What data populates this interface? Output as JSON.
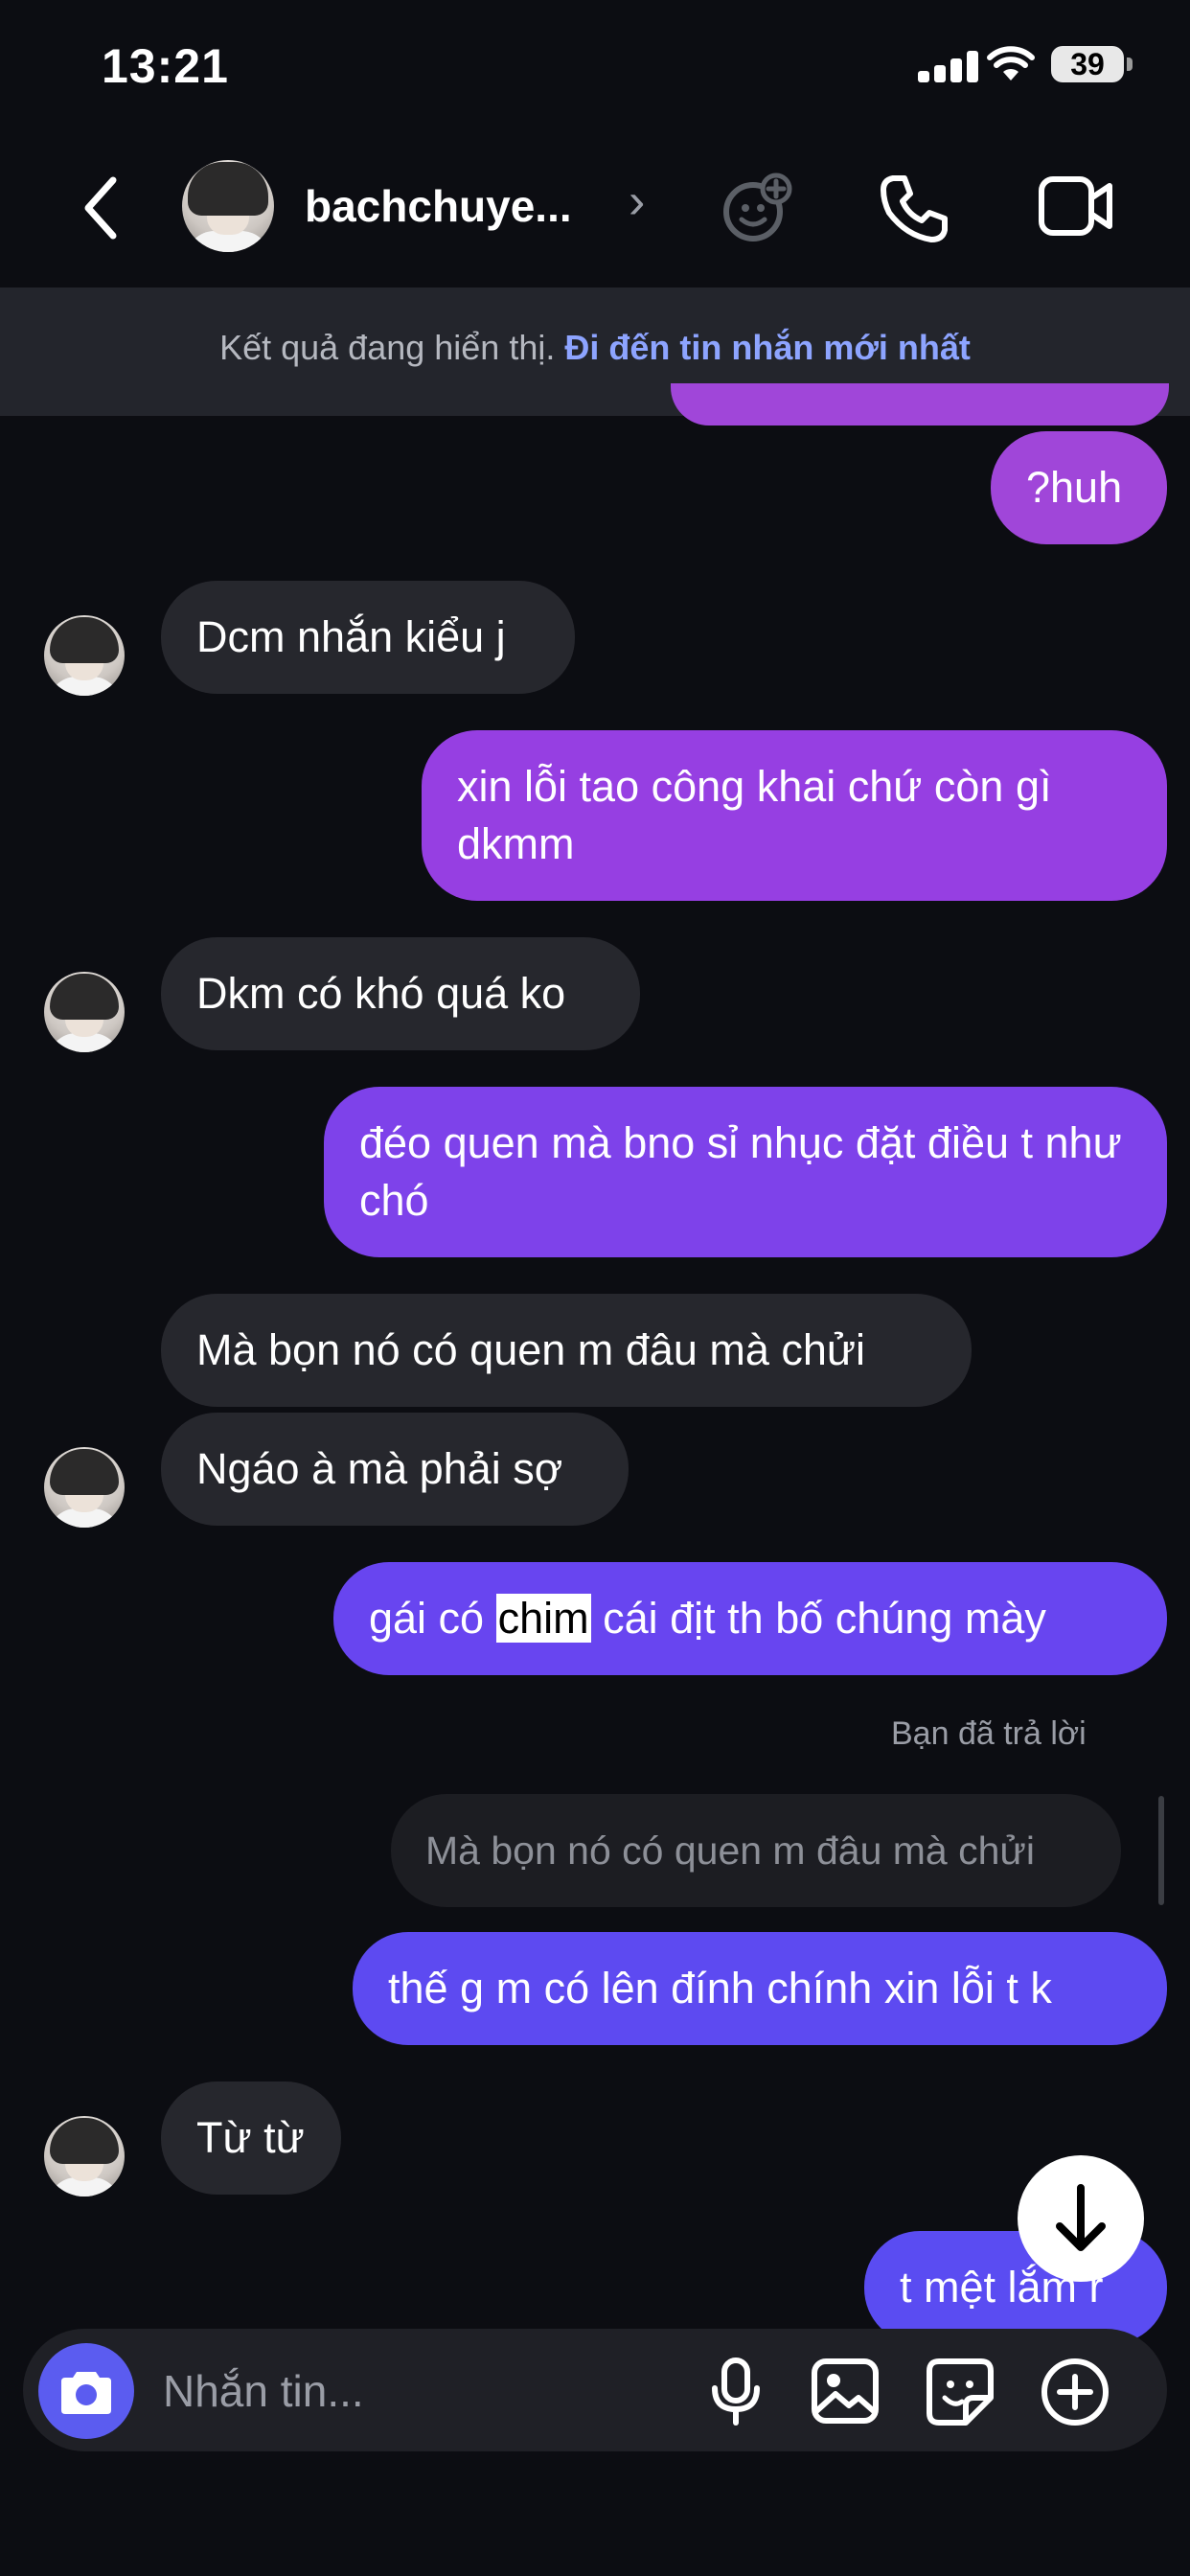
{
  "status_bar": {
    "time": "13:21",
    "battery": "39"
  },
  "header": {
    "username": "bachchuye...",
    "chevron": "›"
  },
  "banner": {
    "text": "Kết quả đang hiển thị. ",
    "link": "Đi đến tin nhắn mới nhất"
  },
  "messages": [
    {
      "side": "out",
      "text": "?huh"
    },
    {
      "side": "in",
      "text": "Dcm nhắn kiểu j"
    },
    {
      "side": "out",
      "text": "xin lỗi tao công khai chứ còn gì dkmm"
    },
    {
      "side": "in",
      "text": "Dkm có khó quá ko"
    },
    {
      "side": "out",
      "text": "đéo quen mà bno sỉ nhục đặt điều t như chó"
    },
    {
      "side": "in",
      "text": "Mà bọn nó có quen m đâu mà chửi"
    },
    {
      "side": "in",
      "text": "Ngáo à mà phải sợ"
    },
    {
      "side": "out",
      "text_before": "gái có ",
      "highlight": "chim",
      "text_after": " cái địt th bố chúng mày"
    },
    {
      "side": "out",
      "reply_label": "Bạn đã trả lời",
      "reply_quote": "Mà bọn nó có quen m đâu mà chửi",
      "text": "thế g m có lên đính chính xin lỗi t k"
    },
    {
      "side": "in",
      "text": "Từ từ"
    },
    {
      "side": "out",
      "text": "t mệt lắm r"
    }
  ],
  "composer": {
    "placeholder": "Nhắn tin..."
  },
  "colors": {
    "background": "#0c0d12",
    "incoming_bubble": "#26272d",
    "outgoing_gradient": [
      "#a046d9",
      "#8a44e6",
      "#6a45f0",
      "#5a4cf2"
    ],
    "accent": "#5b5cf0",
    "banner_link": "#8da4ff"
  },
  "icons": [
    "back-arrow-icon",
    "chevron-right-icon",
    "effects-icon",
    "phone-icon",
    "video-camera-icon",
    "camera-icon",
    "microphone-icon",
    "gallery-icon",
    "sticker-icon",
    "plus-circle-icon",
    "arrow-down-icon"
  ]
}
